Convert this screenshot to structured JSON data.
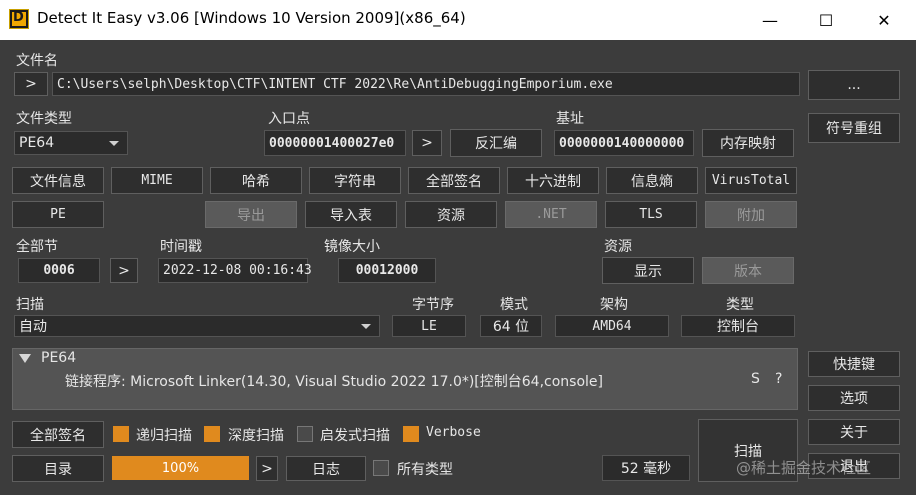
{
  "window": {
    "title": "Detect It Easy v3.06 [Windows 10 Version 2009](x86_64)",
    "minimize": "—",
    "maximize": "☐",
    "close": "✕"
  },
  "file": {
    "label": "文件名",
    "expand": ">",
    "path": "C:\\Users\\selph\\Desktop\\CTF\\INTENT CTF 2022\\Re\\AntiDebuggingEmporium.exe",
    "browse": "..."
  },
  "filetype": {
    "label": "文件类型",
    "value": "PE64"
  },
  "entry": {
    "label": "入口点",
    "value": "00000001400027e0",
    "go": ">",
    "disasm": "反汇编"
  },
  "base": {
    "label": "基址",
    "value": "0000000140000000",
    "memmap": "内存映射"
  },
  "symbols": "符号重组",
  "row1": [
    "文件信息",
    "MIME",
    "哈希",
    "字符串",
    "全部签名",
    "十六进制",
    "信息熵",
    "VirusTotal"
  ],
  "row2": [
    "PE",
    "导出",
    "导入表",
    "资源",
    ".NET",
    "TLS",
    "附加"
  ],
  "sections": {
    "label": "全部节",
    "value": "0006",
    "go": ">"
  },
  "timestamp": {
    "label": "时间戳",
    "value": "2022-12-08 00:16:43"
  },
  "imagesize": {
    "label": "镜像大小",
    "value": "00012000"
  },
  "resources": {
    "label": "资源",
    "show": "显示",
    "version": "版本"
  },
  "scan": {
    "label": "扫描",
    "mode": "自动",
    "endian_label": "字节序",
    "endian": "LE",
    "mode_label": "模式",
    "bits": "64 位",
    "arch_label": "架构",
    "arch": "AMD64",
    "type_label": "类型",
    "type": "控制台"
  },
  "result": {
    "header": "PE64",
    "line": "链接程序: Microsoft Linker(14.30, Visual Studio 2022 17.0*)[控制台64,console]",
    "s": "S",
    "q": "?"
  },
  "side": {
    "shortcuts": "快捷键",
    "options": "选项",
    "about": "关于",
    "exit": "退出"
  },
  "bottom": {
    "allsig": "全部签名",
    "recursive": "递归扫描",
    "deep": "深度扫描",
    "heuristic": "启发式扫描",
    "verbose": "Verbose",
    "dir": "目录",
    "progress": "100%",
    "progress_value": 1.0,
    "go": ">",
    "log": "日志",
    "alltypes": "所有类型",
    "time": "52 毫秒",
    "scanbtn": "扫描"
  },
  "watermark": "@稀土掘金技术社区",
  "colors": {
    "accent": "#e08a1e",
    "background": "#3c3c3c"
  }
}
